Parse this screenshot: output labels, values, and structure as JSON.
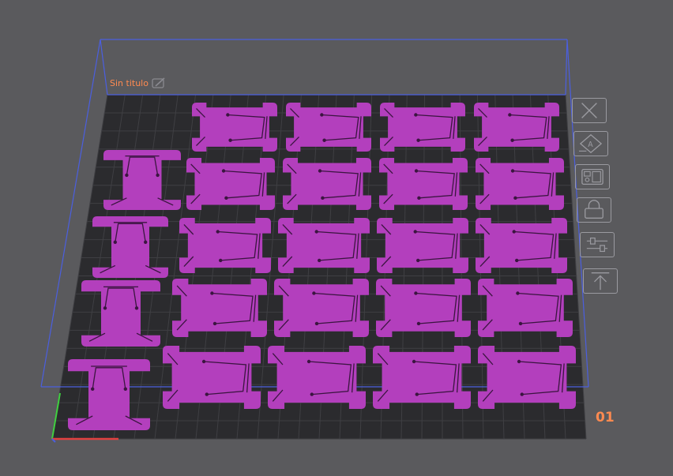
{
  "plate": {
    "name": "Sin titulo",
    "number": "01"
  },
  "colors": {
    "background": "#5a5a5d",
    "bed": "#2b2b2e",
    "grid_line": "#3f3f43",
    "part": "#b33fbd",
    "part_detail": "#3b1540",
    "bounding_box": "#4b5fe0",
    "label": "#ff8a50",
    "toolbar_icon": "#9a9aa0"
  },
  "toolbar": {
    "items": [
      {
        "name": "delete-button",
        "icon": "close-icon"
      },
      {
        "name": "auto-arrange-button",
        "icon": "arrange-icon"
      },
      {
        "name": "layout-button",
        "icon": "layout-icon"
      },
      {
        "name": "lock-button",
        "icon": "lock-icon"
      },
      {
        "name": "settings-button",
        "icon": "sliders-icon"
      },
      {
        "name": "upload-button",
        "icon": "upload-icon"
      }
    ]
  },
  "parts": {
    "horizontal_rows": 5,
    "horizontal_cols": 4,
    "vertical_count": 4,
    "total": 24
  }
}
